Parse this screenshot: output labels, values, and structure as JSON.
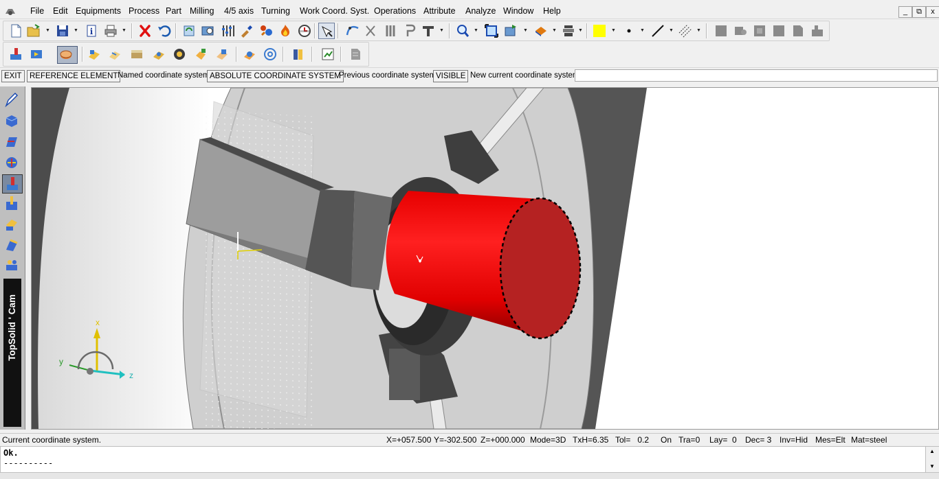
{
  "menu": {
    "items": [
      "File",
      "Edit",
      "Equipments",
      "Process",
      "Part",
      "Milling",
      "4/5 axis",
      "Turning",
      "Work Coord. Syst.",
      "Operations",
      "Attribute",
      "Analyze",
      "Window",
      "Help"
    ],
    "window_controls": [
      "_",
      "⧉",
      "x"
    ]
  },
  "toolbar1": {
    "icons": [
      "new-file-icon",
      "open-file-icon",
      "save-icon",
      "info-icon",
      "print-icon",
      "delete-icon",
      "undo-icon",
      "refresh-icon",
      "zoom-window-icon",
      "tools-icon",
      "brush-icon",
      "process-icon",
      "fire-icon",
      "clock-icon",
      "select-icon",
      "curve-icon",
      "scissors-icon",
      "parallel-icon",
      "hook-icon",
      "text-icon",
      "zoom-icon",
      "fit-icon",
      "view-icon",
      "render-icon",
      "layers-icon",
      "yellow-color-swatch",
      "point-style-icon",
      "line-style-icon",
      "hatch-icon",
      "gray-tool-1-icon",
      "gray-tool-2-icon",
      "gray-tool-3-icon",
      "gray-tool-4-icon",
      "gray-tool-5-icon",
      "gray-tool-6-icon"
    ],
    "highlight_color": "#ffff00"
  },
  "toolbar2": {
    "icons": [
      "machining-icon",
      "simulation-icon",
      "active-operation-icon",
      "part-1-icon",
      "part-2-icon",
      "part-3-icon",
      "part-4-icon",
      "part-5-icon",
      "part-6-icon",
      "part-7-icon",
      "coordinate-icon",
      "circle-target-icon",
      "tool-library-icon",
      "report-icon",
      "document-icon"
    ]
  },
  "command": {
    "exit_label": "EXIT",
    "reference_label": "REFERENCE ELEMENT",
    "named_label": "Named coordinate system=",
    "named_value": "ABSOLUTE COORDINATE SYSTEM",
    "previous_label": "Previous coordinate system=",
    "previous_value": "VISIBLE",
    "new_label": "New current coordinate system:",
    "new_value": ""
  },
  "palette": {
    "brand": "TopSolid ' Cam",
    "icons": [
      "sketch-icon",
      "solid-icon",
      "surface-icon",
      "assembly-icon",
      "machining-active-icon",
      "drilling-icon",
      "pocket-icon",
      "contour-icon",
      "tooling-icon"
    ]
  },
  "viewport": {
    "triad": {
      "x_label": "x",
      "y_label": "y",
      "z_label": "z"
    },
    "part_color": "#e00000",
    "part_face_color": "#b22222"
  },
  "status": {
    "message": "Current coordinate system.",
    "x": "X=+057.500",
    "y": "Y=-302.500",
    "z": "Z=+000.000",
    "mode": "Mode=3D",
    "txh": "TxH=6.35",
    "tol": "Tol=   0.2",
    "on": "On",
    "tra": "Tra=0",
    "lay": "Lay=  0",
    "dec": "Dec= 3",
    "inv": "Inv=Hid",
    "mes": "Mes=Elt",
    "mat": "Mat=steel"
  },
  "output": {
    "line1": "Ok.",
    "line2": "----------"
  }
}
